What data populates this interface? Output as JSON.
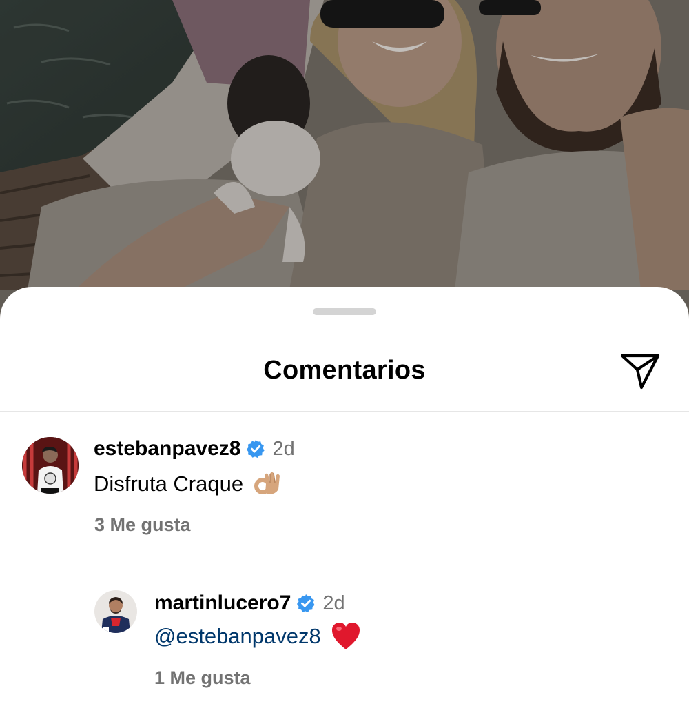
{
  "sheet": {
    "title": "Comentarios"
  },
  "comments": [
    {
      "username": "estebanpavez8",
      "verified": true,
      "time": "2d",
      "text": "Disfruta Craque",
      "emoji": "ok-hand",
      "likes": "3 Me gusta"
    },
    {
      "username": "martinlucero7",
      "verified": true,
      "time": "2d",
      "mention": "@estebanpavez8",
      "emoji": "red-heart",
      "likes": "1 Me gusta"
    }
  ],
  "colors": {
    "verified_blue": "#3897f0",
    "mention_blue": "#00376b",
    "muted_gray": "#737373",
    "heart_red": "#e0182d"
  }
}
